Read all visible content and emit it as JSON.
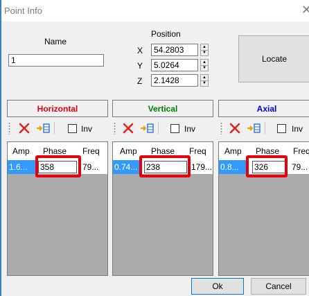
{
  "window": {
    "title": "Point Info",
    "close_glyph": "✕"
  },
  "name": {
    "label": "Name",
    "value": "1"
  },
  "position": {
    "label": "Position",
    "x": {
      "label": "X",
      "value": "54.2803"
    },
    "y": {
      "label": "Y",
      "value": "5.0264"
    },
    "z": {
      "label": "Z",
      "value": "2.1428"
    }
  },
  "locate_label": "Locate",
  "panels": [
    {
      "title": "Horizontal",
      "color": "#e0000b",
      "inv_label": "Inv",
      "columns": [
        "Amp",
        "Phase",
        "Freq"
      ],
      "amp": "1.6...",
      "phase": "358",
      "freq": "79..."
    },
    {
      "title": "Vertical",
      "color": "#008000",
      "inv_label": "Inv",
      "columns": [
        "Amp",
        "Phase",
        "Freq"
      ],
      "amp": "0.74...",
      "phase": "238",
      "freq": "179..."
    },
    {
      "title": "Axial",
      "color": "#0000e0",
      "inv_label": "Inv",
      "columns": [
        "Amp",
        "Phase",
        "Freq"
      ],
      "amp": "0.8...",
      "phase": "326",
      "freq": "79..."
    }
  ],
  "buttons": {
    "ok": "Ok",
    "cancel": "Cancel"
  },
  "colors": {
    "highlight": "#e8000b",
    "selection": "#3399ff",
    "delete_icon": "#e02020"
  },
  "icons": [
    "close-icon",
    "delete-icon",
    "insert-column-icon",
    "spin-up-icon",
    "spin-down-icon"
  ]
}
